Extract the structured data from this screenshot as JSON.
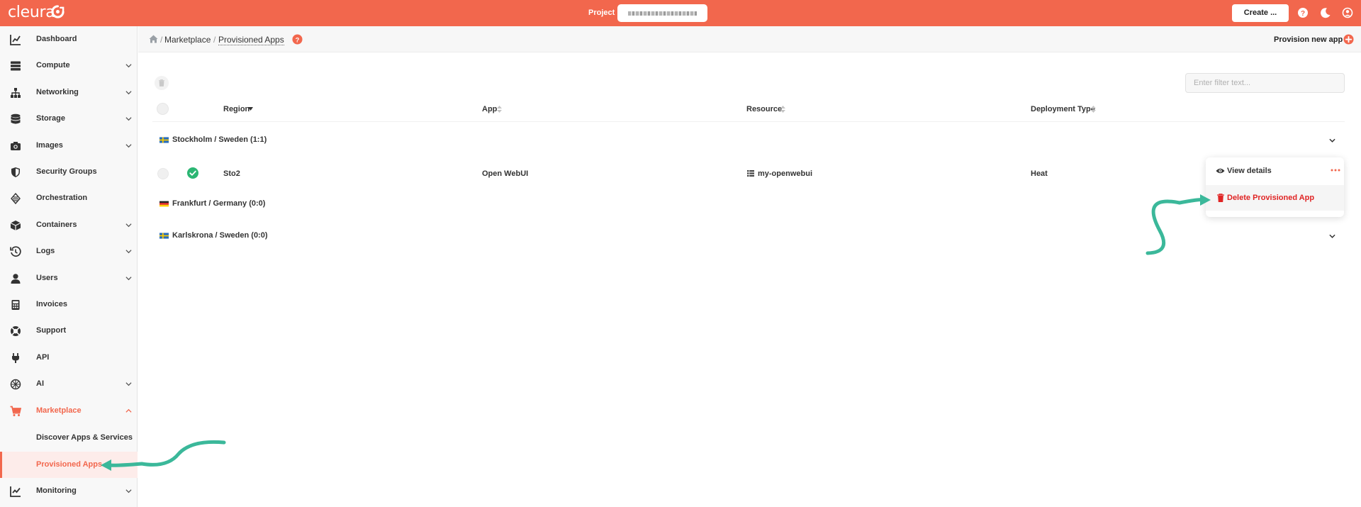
{
  "header": {
    "logo_text": "cleura",
    "project_label": "Project",
    "create_label": "Create ...",
    "icons": [
      "help-icon",
      "moon-icon",
      "user-icon"
    ]
  },
  "sidebar": {
    "items": [
      {
        "label": "Dashboard",
        "icon": "chart-icon",
        "expandable": false
      },
      {
        "label": "Compute",
        "icon": "server-icon",
        "expandable": true
      },
      {
        "label": "Networking",
        "icon": "network-icon",
        "expandable": true
      },
      {
        "label": "Storage",
        "icon": "database-icon",
        "expandable": true
      },
      {
        "label": "Images",
        "icon": "camera-icon",
        "expandable": true
      },
      {
        "label": "Security Groups",
        "icon": "shield-icon",
        "expandable": false
      },
      {
        "label": "Orchestration",
        "icon": "orchestration-icon",
        "expandable": false
      },
      {
        "label": "Containers",
        "icon": "cube-icon",
        "expandable": true
      },
      {
        "label": "Logs",
        "icon": "history-icon",
        "expandable": true
      },
      {
        "label": "Users",
        "icon": "user-icon",
        "expandable": true
      },
      {
        "label": "Invoices",
        "icon": "calculator-icon",
        "expandable": false
      },
      {
        "label": "Support",
        "icon": "lifering-icon",
        "expandable": false
      },
      {
        "label": "API",
        "icon": "plug-icon",
        "expandable": false
      },
      {
        "label": "AI",
        "icon": "ai-icon",
        "expandable": true
      },
      {
        "label": "Marketplace",
        "icon": "cart-icon",
        "expandable": true,
        "active": true
      }
    ],
    "marketplace_sub": [
      {
        "label": "Discover Apps & Services"
      },
      {
        "label": "Provisioned Apps",
        "current": true
      }
    ],
    "last_item": {
      "label": "Monitoring",
      "icon": "monitoring-icon",
      "expandable": true
    }
  },
  "breadcrumb": {
    "items": [
      "Marketplace",
      "Provisioned Apps"
    ],
    "separator": "/",
    "provision_label": "Provision new app"
  },
  "table": {
    "filter_placeholder": "Enter filter text...",
    "columns": [
      "Region",
      "App",
      "Resource",
      "Deployment Type"
    ],
    "groups": [
      {
        "label": "Stockholm / Sweden",
        "count": "(1:1)",
        "flag": "sweden"
      },
      {
        "label": "Frankfurt / Germany",
        "count": "(0:0)",
        "flag": "germany"
      },
      {
        "label": "Karlskrona / Sweden",
        "count": "(0:0)",
        "flag": "sweden"
      }
    ],
    "rows": [
      {
        "region": "Sto2",
        "app": "Open WebUI",
        "resource": "my-openwebui",
        "deployment_type": "Heat",
        "status": "ok"
      }
    ]
  },
  "row_menu": {
    "items": [
      {
        "label": "View details",
        "icon": "eye-icon"
      },
      {
        "label": "Delete Provisioned App",
        "icon": "trash-icon",
        "danger": true
      }
    ]
  },
  "colors": {
    "brand": "#f2674d",
    "annotation_arrow": "#3bb89a",
    "danger": "#e02424",
    "success": "#2bb673"
  }
}
